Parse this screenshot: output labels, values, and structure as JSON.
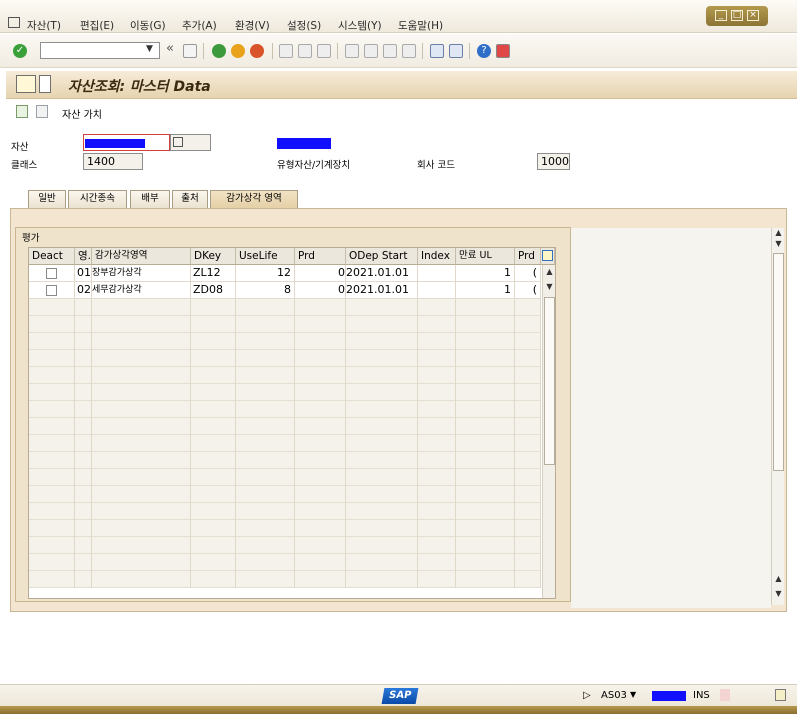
{
  "menu": [
    "자산(T)",
    "편집(E)",
    "이동(G)",
    "추가(A)",
    "환경(V)",
    "설정(S)",
    "시스템(Y)",
    "도움말(H)"
  ],
  "toolbar": {
    "command_value": "",
    "nav_back": "«"
  },
  "title": "자산조회: 마스터 Data",
  "app_toolbar": {
    "asset_value_label": "자산 가치"
  },
  "header": {
    "asset_label": "자산",
    "class_label": "클래스",
    "class_value": "1400",
    "asset_desc_label": "유형자산/기계장치",
    "company_code_label": "회사 코드",
    "company_code_value": "1000"
  },
  "tabs": [
    "일반",
    "시간종속",
    "배부",
    "출처",
    "감가상각 영역"
  ],
  "active_tab": "감가상각 영역",
  "group_title": "평가",
  "table": {
    "columns": [
      "Deact",
      "영.",
      "감가상각영역",
      "DKey",
      "UseLife",
      "Prd",
      "ODep Start",
      "Index",
      "만료 UL",
      "Prd"
    ],
    "rows": [
      {
        "deact": false,
        "area": "01",
        "area_name": "장부감가상각",
        "dkey": "ZL12",
        "uselife": "12",
        "prd": "0",
        "odep_start": "2021.01.01",
        "index": "",
        "exp_ul": "1",
        "prd2": "("
      },
      {
        "deact": false,
        "area": "02",
        "area_name": "세무감가상각",
        "dkey": "ZD08",
        "uselife": "8",
        "prd": "0",
        "odep_start": "2021.01.01",
        "index": "",
        "exp_ul": "1",
        "prd2": "("
      }
    ]
  },
  "status": {
    "tcode": "AS03",
    "mode": "INS",
    "sap_logo": "SAP"
  },
  "colors": {
    "accent": "#1010ff",
    "title_bg": "#e6d4b0",
    "panel_bg": "#f3e5cf"
  }
}
